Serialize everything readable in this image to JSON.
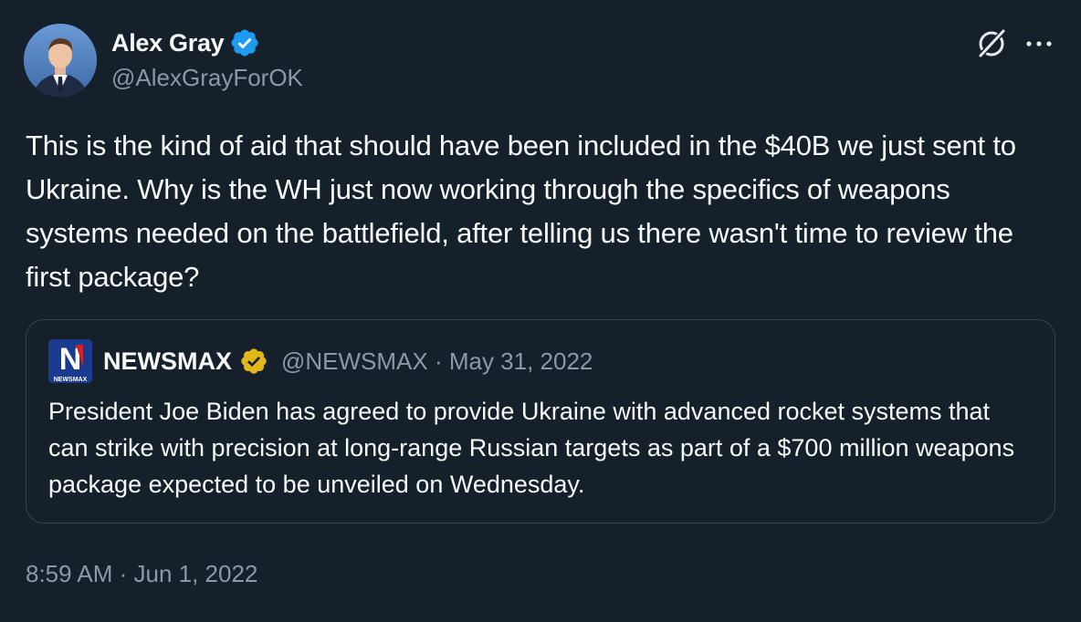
{
  "author": {
    "name": "Alex Gray",
    "handle": "@AlexGrayForOK",
    "verified_badge_icon": "verified-badge-icon",
    "avatar_icon": "avatar"
  },
  "header_actions": {
    "grok_icon": "xai-icon",
    "more_icon": "more-icon"
  },
  "tweet": {
    "text": "This is the kind of aid that should have been included in the $40B we just sent to Ukraine. Why is the WH just now working through the specifics of weapons systems needed on the battlefield, after telling us there wasn't time to review the first package?",
    "timestamp": "8:59 AM · Jun 1, 2022"
  },
  "quote": {
    "logo_letter": "N",
    "logo_text": "NEWSMAX",
    "name": "NEWSMAX",
    "meta": "@NEWSMAX · May 31, 2022",
    "text": "President Joe Biden has agreed to provide Ukraine with advanced rocket systems that can strike with precision at long-range Russian targets as part of a $700 million weapons package expected to be unveiled on Wednesday."
  },
  "colors": {
    "background": "#15202b",
    "primary_text": "#f7f9f9",
    "secondary_text": "#8b98a5",
    "border": "#38444d",
    "verified_blue": "#1d9bf0",
    "verified_gold": "#e2b719",
    "newsmax_blue": "#1a3a8f",
    "newsmax_red": "#d6202a"
  }
}
